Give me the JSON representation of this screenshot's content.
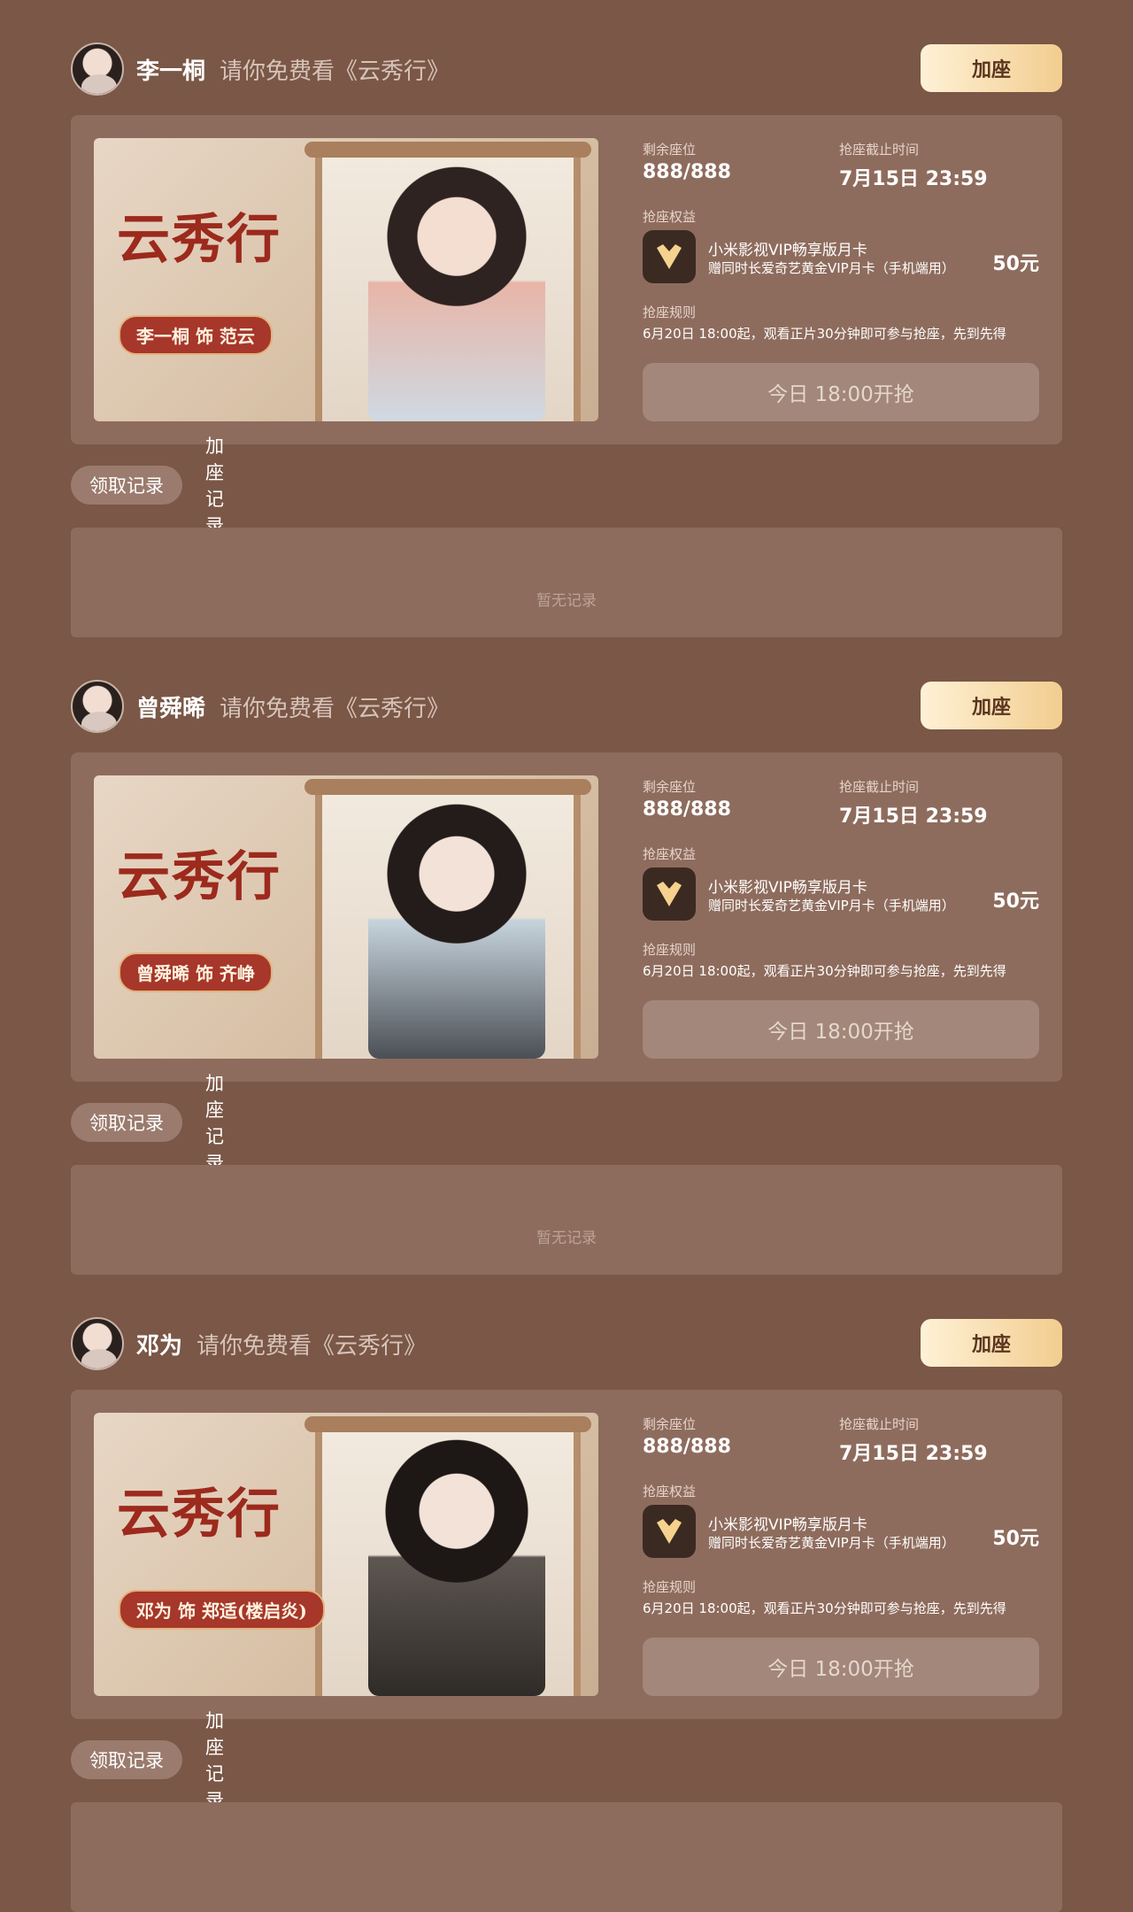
{
  "sections": [
    {
      "user_name": "李一桐",
      "invite_text": "请你免费看《云秀行》",
      "add_seat_label": "加座",
      "poster_title": "云秀行",
      "poster_cast": "李一桐 饰 范云",
      "remaining_seats_label": "剩余座位",
      "remaining_seats": "888/888",
      "deadline_label": "抢座截止时间",
      "deadline": "7月15日 23:59",
      "benefit_label": "抢座权益",
      "benefit_line1": "小米影视VIP畅享版月卡",
      "benefit_line2": "赠同时长爱奇艺黄金VIP月卡（手机端用）",
      "benefit_price": "50元",
      "rule_label": "抢座规则",
      "rule_text": "6月20日 18:00起，观看正片30分钟即可参与抢座，先到先得",
      "grab_button": "今日 18:00开抢",
      "tab_active": "领取记录",
      "tab_inactive": "加座记录",
      "empty_text": "暂无记录"
    },
    {
      "user_name": "曾舜晞",
      "invite_text": "请你免费看《云秀行》",
      "add_seat_label": "加座",
      "poster_title": "云秀行",
      "poster_cast": "曾舜晞 饰 齐峥",
      "remaining_seats_label": "剩余座位",
      "remaining_seats": "888/888",
      "deadline_label": "抢座截止时间",
      "deadline": "7月15日 23:59",
      "benefit_label": "抢座权益",
      "benefit_line1": "小米影视VIP畅享版月卡",
      "benefit_line2": "赠同时长爱奇艺黄金VIP月卡（手机端用）",
      "benefit_price": "50元",
      "rule_label": "抢座规则",
      "rule_text": "6月20日 18:00起，观看正片30分钟即可参与抢座，先到先得",
      "grab_button": "今日 18:00开抢",
      "tab_active": "领取记录",
      "tab_inactive": "加座记录",
      "empty_text": "暂无记录"
    },
    {
      "user_name": "邓为",
      "invite_text": "请你免费看《云秀行》",
      "add_seat_label": "加座",
      "poster_title": "云秀行",
      "poster_cast": "邓为 饰 郑适(楼启炎)",
      "remaining_seats_label": "剩余座位",
      "remaining_seats": "888/888",
      "deadline_label": "抢座截止时间",
      "deadline": "7月15日 23:59",
      "benefit_label": "抢座权益",
      "benefit_line1": "小米影视VIP畅享版月卡",
      "benefit_line2": "赠同时长爱奇艺黄金VIP月卡（手机端用）",
      "benefit_price": "50元",
      "rule_label": "抢座规则",
      "rule_text": "6月20日 18:00起，观看正片30分钟即可参与抢座，先到先得",
      "grab_button": "今日 18:00开抢",
      "tab_active": "领取记录",
      "tab_inactive": "加座记录",
      "empty_text": ""
    }
  ],
  "colors": {
    "background": "#7a5746",
    "card": "#8e6c5d",
    "gold_button_start": "#fff1d6",
    "gold_button_end": "#f2cd8f",
    "poster_red": "#9c2a1d"
  },
  "icons": {
    "benefit": "heart-shield-icon"
  }
}
